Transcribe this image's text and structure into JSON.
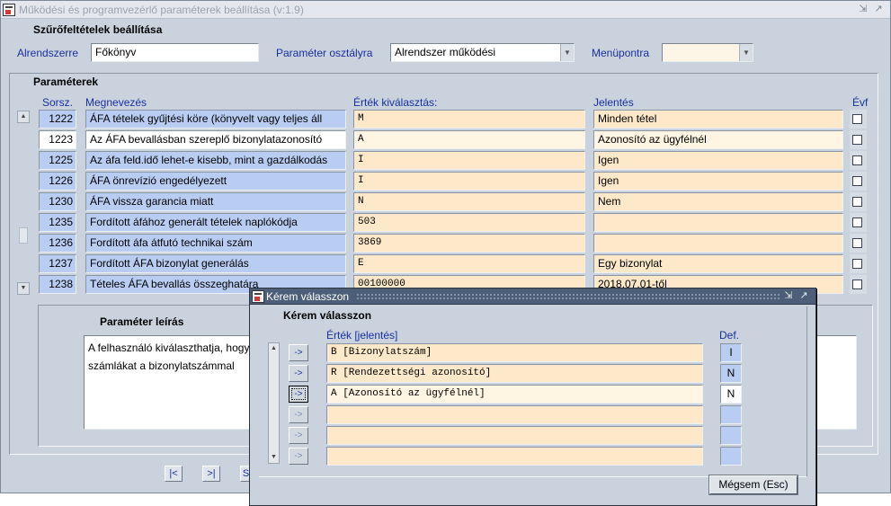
{
  "window": {
    "title": "Működési és programvezérlő paraméterek beállítása (v:1.9)",
    "minimize": "⇲",
    "maximize": "↗"
  },
  "filters": {
    "section_title": "Szűrőfeltételek beállítása",
    "subsystem_label": "Alrendszerre",
    "subsystem_value": "Főkönyv",
    "class_label": "Paraméter osztályra",
    "class_value": "Alrendszer működési",
    "menu_label": "Menüpontra",
    "menu_value": ""
  },
  "params": {
    "section_title": "Paraméterek",
    "headers": {
      "num": "Sorsz.",
      "name": "Megnevezés",
      "value": "Érték kiválasztás:",
      "meaning": "Jelentés",
      "year": "Évf"
    },
    "rows": [
      {
        "num": "1222",
        "name": "ÁFA tételek gyűjtési köre (könyvelt vagy teljes áll",
        "value": "M",
        "meaning": "Minden tétel"
      },
      {
        "num": "1223",
        "name": "Az ÁFA bevallásban szereplő bizonylatazonosító",
        "value": "A",
        "meaning": "Azonosító az ügyfélnél"
      },
      {
        "num": "1225",
        "name": "Az áfa feld.idő lehet-e kisebb, mint a gazdálkodás",
        "value": "I",
        "meaning": "Igen"
      },
      {
        "num": "1226",
        "name": "ÁFA önrevízió engedélyezett",
        "value": "I",
        "meaning": "Igen"
      },
      {
        "num": "1230",
        "name": "ÁFA vissza garancia miatt",
        "value": "N",
        "meaning": "Nem"
      },
      {
        "num": "1235",
        "name": "Fordított áfához generált tételek naplókódja",
        "value": "503",
        "meaning": ""
      },
      {
        "num": "1236",
        "name": "Fordított áfa átfutó technikai szám",
        "value": "3869",
        "meaning": ""
      },
      {
        "num": "1237",
        "name": "Fordított ÁFA bizonylat generálás",
        "value": "E",
        "meaning": "Egy bizonylat"
      },
      {
        "num": "1238",
        "name": "Tételes ÁFA bevallás összeghatára",
        "value": "00100000",
        "meaning": "2018.07.01-től"
      }
    ]
  },
  "description": {
    "section_title": "Paraméter leírás",
    "text_line1": "A felhasználó kiválaszthatja, hogy",
    "text_line2": "számlákat a bizonylatszámmal"
  },
  "nav": {
    "first": "|<",
    "last": ">|",
    "partial": "S"
  },
  "dialog": {
    "title": "Kérem válasszon",
    "heading": "Kérem válasszon",
    "value_header": "Érték  [jelentés]",
    "def_header": "Def.",
    "arrow_label": "->",
    "cancel_label": "Mégsem (Esc)",
    "options": [
      {
        "value": "B [Bizonylatszám]",
        "def": "I"
      },
      {
        "value": "R [Rendezettségi azonosító]",
        "def": "N"
      },
      {
        "value": "A [Azonosító az ügyfélnél]",
        "def": "N"
      },
      {
        "value": "",
        "def": ""
      },
      {
        "value": "",
        "def": ""
      },
      {
        "value": "",
        "def": ""
      }
    ]
  }
}
